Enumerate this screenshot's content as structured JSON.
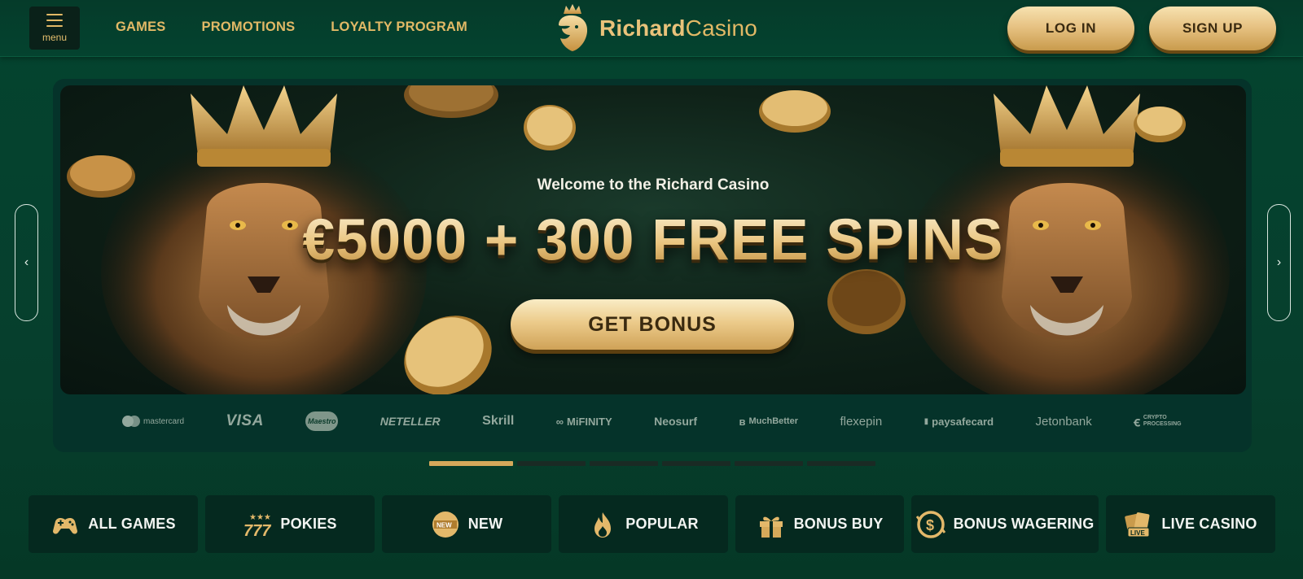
{
  "header": {
    "menu_label": "menu",
    "nav": [
      "GAMES",
      "PROMOTIONS",
      "LOYALTY PROGRAM"
    ],
    "logo_bold": "Richard",
    "logo_light": "Casino",
    "login_label": "LOG IN",
    "signup_label": "SIGN UP"
  },
  "hero": {
    "welcome": "Welcome to the Richard Casino",
    "title": "€5000 + 300 FREE SPINS",
    "cta": "GET BONUS",
    "slide_count": 6,
    "active_slide": 1
  },
  "payments": [
    "mastercard",
    "VISA",
    "Maestro",
    "NETELLER",
    "Skrill",
    "MiFINITY",
    "Neosurf",
    "MuchBetter",
    "flexepin",
    "paysafecard",
    "Jetonbank",
    "CRYPTO PROCESSING"
  ],
  "categories": [
    {
      "label": "ALL GAMES",
      "icon": "gamepad-icon"
    },
    {
      "label": "POKIES",
      "icon": "slot-777-icon"
    },
    {
      "label": "NEW",
      "icon": "new-badge-icon"
    },
    {
      "label": "POPULAR",
      "icon": "flame-icon"
    },
    {
      "label": "BONUS BUY",
      "icon": "gift-icon"
    },
    {
      "label": "BONUS WAGERING",
      "icon": "dollar-coin-icon"
    },
    {
      "label": "LIVE CASINO",
      "icon": "live-cards-icon"
    }
  ],
  "colors": {
    "background": "#04442f",
    "gold": "#e2b966",
    "category_bg": "#05291f",
    "progress_active": "#d6a85a"
  }
}
